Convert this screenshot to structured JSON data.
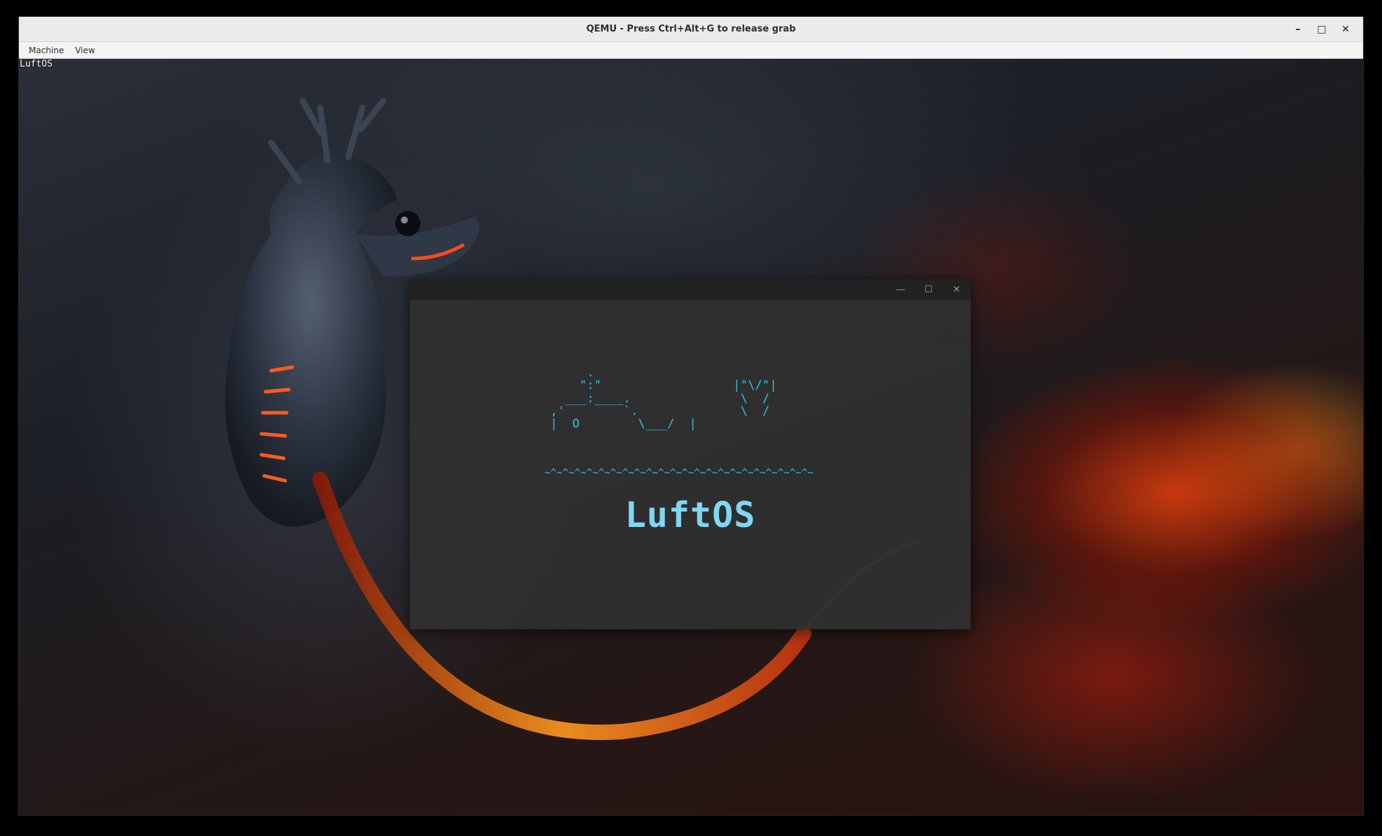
{
  "host_window": {
    "title": "QEMU - Press Ctrl+Alt+G to release grab",
    "controls": {
      "minimize": "–",
      "maximize": "□",
      "close": "✕"
    }
  },
  "menubar": {
    "items": [
      "Machine",
      "View"
    ]
  },
  "guest": {
    "desktop_label": "LuftOS",
    "app_window": {
      "controls": {
        "minimize": "—",
        "maximize": "☐",
        "close": "✕"
      },
      "art_lines": "      .\n     \":\"                  |\"\\/\"|\n   ___:____.               \\  /\n ,'        `.              \\  /\n |  O        \\___/  |",
      "waves": "~^~^~^~^~^~^~^~^~^~^~^~^~^~^~^~^~^~^~^~^~^~^~",
      "title": "LuftOS"
    },
    "colors": {
      "accent": "#36c3e6",
      "title": "#7fd8f2"
    }
  }
}
